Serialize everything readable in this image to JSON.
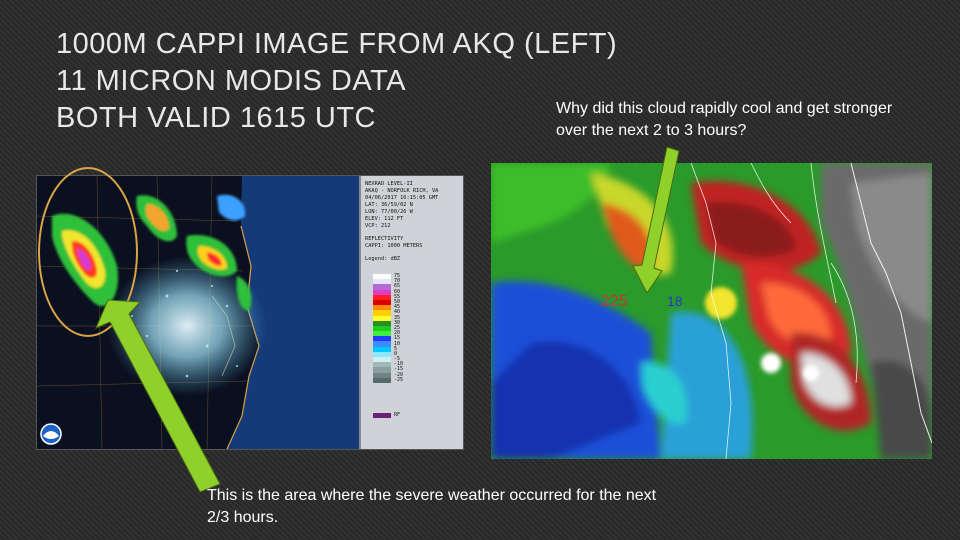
{
  "title": {
    "line1": "1000M CAPPI IMAGE FROM AKQ (LEFT)",
    "line2": "11 MICRON MODIS DATA",
    "line3": "BOTH VALID 1615 UTC"
  },
  "question_text": "Why did this cloud rapidly cool and get stronger over the next 2 to 3 hours?",
  "caption_text": "This is the area where the severe weather occurred for the next 2/3 hours.",
  "radar": {
    "meta_lines": [
      "NEXRAD LEVEL-II",
      "AKAQ - NORFOLK RICH, VA",
      "04/06/2017 16:15:05 GMT",
      "LAT: 36/59/02 N",
      "LON: 77/00/26 W",
      "ELEV: 112 FT",
      "VCP: 212"
    ],
    "product_lines": [
      "REFLECTIVITY",
      "CAPPI: 1000 METERS"
    ],
    "legend_title": "Legend: dBZ",
    "scale": [
      {
        "label": "75",
        "color": "#ffffff"
      },
      {
        "label": "70",
        "color": "#e6e6ff"
      },
      {
        "label": "65",
        "color": "#b36bd6"
      },
      {
        "label": "60",
        "color": "#e03cc8"
      },
      {
        "label": "55",
        "color": "#ff1f1f"
      },
      {
        "label": "50",
        "color": "#d60000"
      },
      {
        "label": "45",
        "color": "#ff8c00"
      },
      {
        "label": "40",
        "color": "#ffd000"
      },
      {
        "label": "35",
        "color": "#ffff33"
      },
      {
        "label": "30",
        "color": "#2a8f1e"
      },
      {
        "label": "25",
        "color": "#1ecc1e"
      },
      {
        "label": "20",
        "color": "#3cf03c"
      },
      {
        "label": "15",
        "color": "#1f3cff"
      },
      {
        "label": "10",
        "color": "#3c8cff"
      },
      {
        "label": "5",
        "color": "#00c8ff"
      },
      {
        "label": "0",
        "color": "#8fe6ff"
      },
      {
        "label": "-5",
        "color": "#cfeff0"
      },
      {
        "label": "-10",
        "color": "#a0b8b8"
      },
      {
        "label": "-15",
        "color": "#8aa0a0"
      },
      {
        "label": "-20",
        "color": "#6f8585"
      },
      {
        "label": "-25",
        "color": "#566a6a"
      }
    ],
    "rf_label": "RF",
    "rf_color": "#6a1f7a"
  },
  "satellite": {
    "label_left": "225",
    "label_right": "18"
  },
  "colors": {
    "arrow": "#8fd12a",
    "circle": "#d9a444"
  }
}
